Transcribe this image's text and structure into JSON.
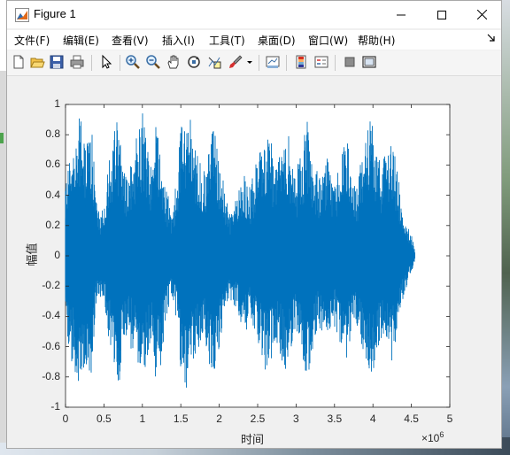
{
  "window": {
    "title": "Figure 1"
  },
  "menu": [
    {
      "label": "文件(F)"
    },
    {
      "label": "编辑(E)"
    },
    {
      "label": "查看(V)"
    },
    {
      "label": "插入(I)"
    },
    {
      "label": "工具(T)"
    },
    {
      "label": "桌面(D)"
    },
    {
      "label": "窗口(W)"
    },
    {
      "label": "帮助(H)"
    }
  ],
  "toolbar_icons": [
    "new-figure-icon",
    "open-icon",
    "save-icon",
    "print-icon",
    "pointer-icon",
    "zoom-in-icon",
    "zoom-out-icon",
    "pan-icon",
    "rotate-3d-icon",
    "data-cursor-icon",
    "brush-icon",
    "brush-dropdown-icon",
    "link-plot-icon",
    "colorbar-icon",
    "legend-icon",
    "hide-plot-tools-icon",
    "show-plot-tools-icon"
  ],
  "chart_data": {
    "type": "line",
    "xlabel": "时间",
    "ylabel": "幅值",
    "x_exponent_label": "×10",
    "x_exponent": "6",
    "xlim": [
      0,
      5000000
    ],
    "ylim": [
      -1,
      1
    ],
    "xticks": [
      "0",
      "0.5",
      "1",
      "1.5",
      "2",
      "2.5",
      "3",
      "3.5",
      "4",
      "4.5",
      "5"
    ],
    "yticks": [
      "1",
      "0.8",
      "0.6",
      "0.4",
      "0.2",
      "0",
      "-0.2",
      "-0.4",
      "-0.6",
      "-0.8",
      "-1"
    ],
    "series": [
      {
        "color": "#0072BD",
        "x_end": 4550000,
        "envelope": {
          "x": [
            0,
            50000,
            100000,
            150000,
            200000,
            250000,
            300000,
            350000,
            400000,
            450000,
            500000,
            550000,
            600000,
            650000,
            700000,
            750000,
            800000,
            850000,
            900000,
            950000,
            1000000,
            1050000,
            1100000,
            1150000,
            1200000,
            1250000,
            1300000,
            1350000,
            1400000,
            1450000,
            1500000,
            1550000,
            1600000,
            1650000,
            1700000,
            1750000,
            1800000,
            1850000,
            1900000,
            1950000,
            2000000,
            2050000,
            2100000,
            2150000,
            2200000,
            2250000,
            2300000,
            2350000,
            2400000,
            2450000,
            2500000,
            2550000,
            2600000,
            2650000,
            2700000,
            2750000,
            2800000,
            2850000,
            2900000,
            2950000,
            3000000,
            3050000,
            3100000,
            3150000,
            3200000,
            3250000,
            3300000,
            3350000,
            3400000,
            3450000,
            3500000,
            3550000,
            3600000,
            3650000,
            3700000,
            3750000,
            3800000,
            3850000,
            3900000,
            3950000,
            4000000,
            4050000,
            4100000,
            4150000,
            4200000,
            4250000,
            4300000,
            4350000,
            4400000,
            4450000,
            4500000,
            4550000
          ],
          "upper": [
            0.55,
            0.7,
            0.75,
            0.85,
            0.95,
            0.7,
            0.9,
            0.85,
            0.35,
            0.3,
            0.3,
            0.55,
            0.75,
            0.9,
            0.85,
            0.6,
            0.55,
            0.65,
            0.7,
            0.8,
            0.95,
            0.75,
            0.6,
            0.8,
            0.9,
            0.7,
            0.45,
            0.35,
            0.3,
            0.55,
            0.9,
            0.95,
            0.8,
            0.85,
            0.75,
            0.6,
            0.55,
            0.7,
            0.8,
            0.85,
            0.65,
            0.5,
            0.35,
            0.3,
            0.35,
            0.4,
            0.6,
            0.5,
            0.45,
            0.55,
            0.65,
            0.7,
            0.85,
            0.8,
            0.7,
            0.6,
            0.75,
            0.85,
            0.8,
            0.65,
            0.5,
            0.7,
            0.75,
            0.9,
            0.7,
            0.55,
            0.5,
            0.6,
            0.65,
            0.55,
            0.45,
            0.6,
            0.75,
            0.8,
            0.65,
            0.45,
            0.5,
            0.7,
            0.85,
            0.9,
            0.85,
            0.7,
            0.6,
            0.65,
            0.75,
            0.8,
            0.6,
            0.45,
            0.35,
            0.2,
            0.12,
            0.03
          ],
          "lower": [
            -0.5,
            -0.65,
            -0.75,
            -0.85,
            -0.95,
            -0.75,
            -0.85,
            -0.8,
            -0.35,
            -0.3,
            -0.3,
            -0.55,
            -0.7,
            -0.85,
            -0.9,
            -0.6,
            -0.55,
            -0.6,
            -0.65,
            -0.8,
            -0.9,
            -0.75,
            -0.6,
            -0.75,
            -0.85,
            -0.75,
            -0.45,
            -0.35,
            -0.3,
            -0.5,
            -0.85,
            -0.95,
            -0.8,
            -0.8,
            -0.75,
            -0.6,
            -0.55,
            -0.7,
            -0.85,
            -0.8,
            -0.65,
            -0.5,
            -0.35,
            -0.3,
            -0.35,
            -0.4,
            -0.55,
            -0.5,
            -0.45,
            -0.5,
            -0.6,
            -0.7,
            -0.8,
            -0.75,
            -0.7,
            -0.6,
            -0.7,
            -0.8,
            -0.75,
            -0.6,
            -0.5,
            -0.65,
            -0.75,
            -0.85,
            -0.7,
            -0.55,
            -0.5,
            -0.55,
            -0.6,
            -0.5,
            -0.45,
            -0.55,
            -0.7,
            -0.75,
            -0.6,
            -0.45,
            -0.5,
            -0.65,
            -0.8,
            -0.85,
            -0.8,
            -0.7,
            -0.6,
            -0.6,
            -0.7,
            -0.75,
            -0.55,
            -0.4,
            -0.3,
            -0.2,
            -0.1,
            -0.03
          ]
        }
      }
    ],
    "grid": false
  }
}
